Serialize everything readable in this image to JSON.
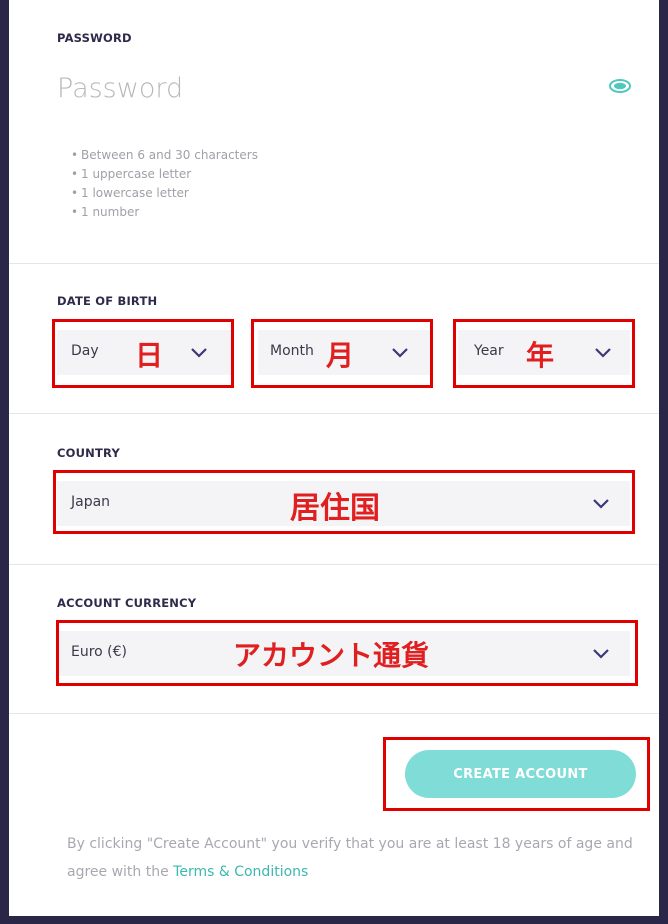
{
  "password": {
    "label": "PASSWORD",
    "placeholder": "Password",
    "rules": [
      "Between 6 and 30 characters",
      "1 uppercase letter",
      "1 lowercase letter",
      "1 number"
    ]
  },
  "dob": {
    "label": "DATE OF BIRTH",
    "day": {
      "value": "Day",
      "annotation": "日"
    },
    "month": {
      "value": "Month",
      "annotation": "月"
    },
    "year": {
      "value": "Year",
      "annotation": "年"
    }
  },
  "country": {
    "label": "COUNTRY",
    "value": "Japan",
    "annotation": "居住国"
  },
  "currency": {
    "label": "ACCOUNT CURRENCY",
    "value": "Euro (€)",
    "annotation": "アカウント通貨"
  },
  "submit_label": "CREATE ACCOUNT",
  "legal": {
    "text": "By clicking \"Create Account\" you verify that you are at least 18 years of age and agree with the ",
    "link": "Terms & Conditions"
  },
  "colors": {
    "accent": "#7fdcd6",
    "link": "#3cb8ae",
    "annotation": "#e00000",
    "frame": "#2a2648"
  }
}
